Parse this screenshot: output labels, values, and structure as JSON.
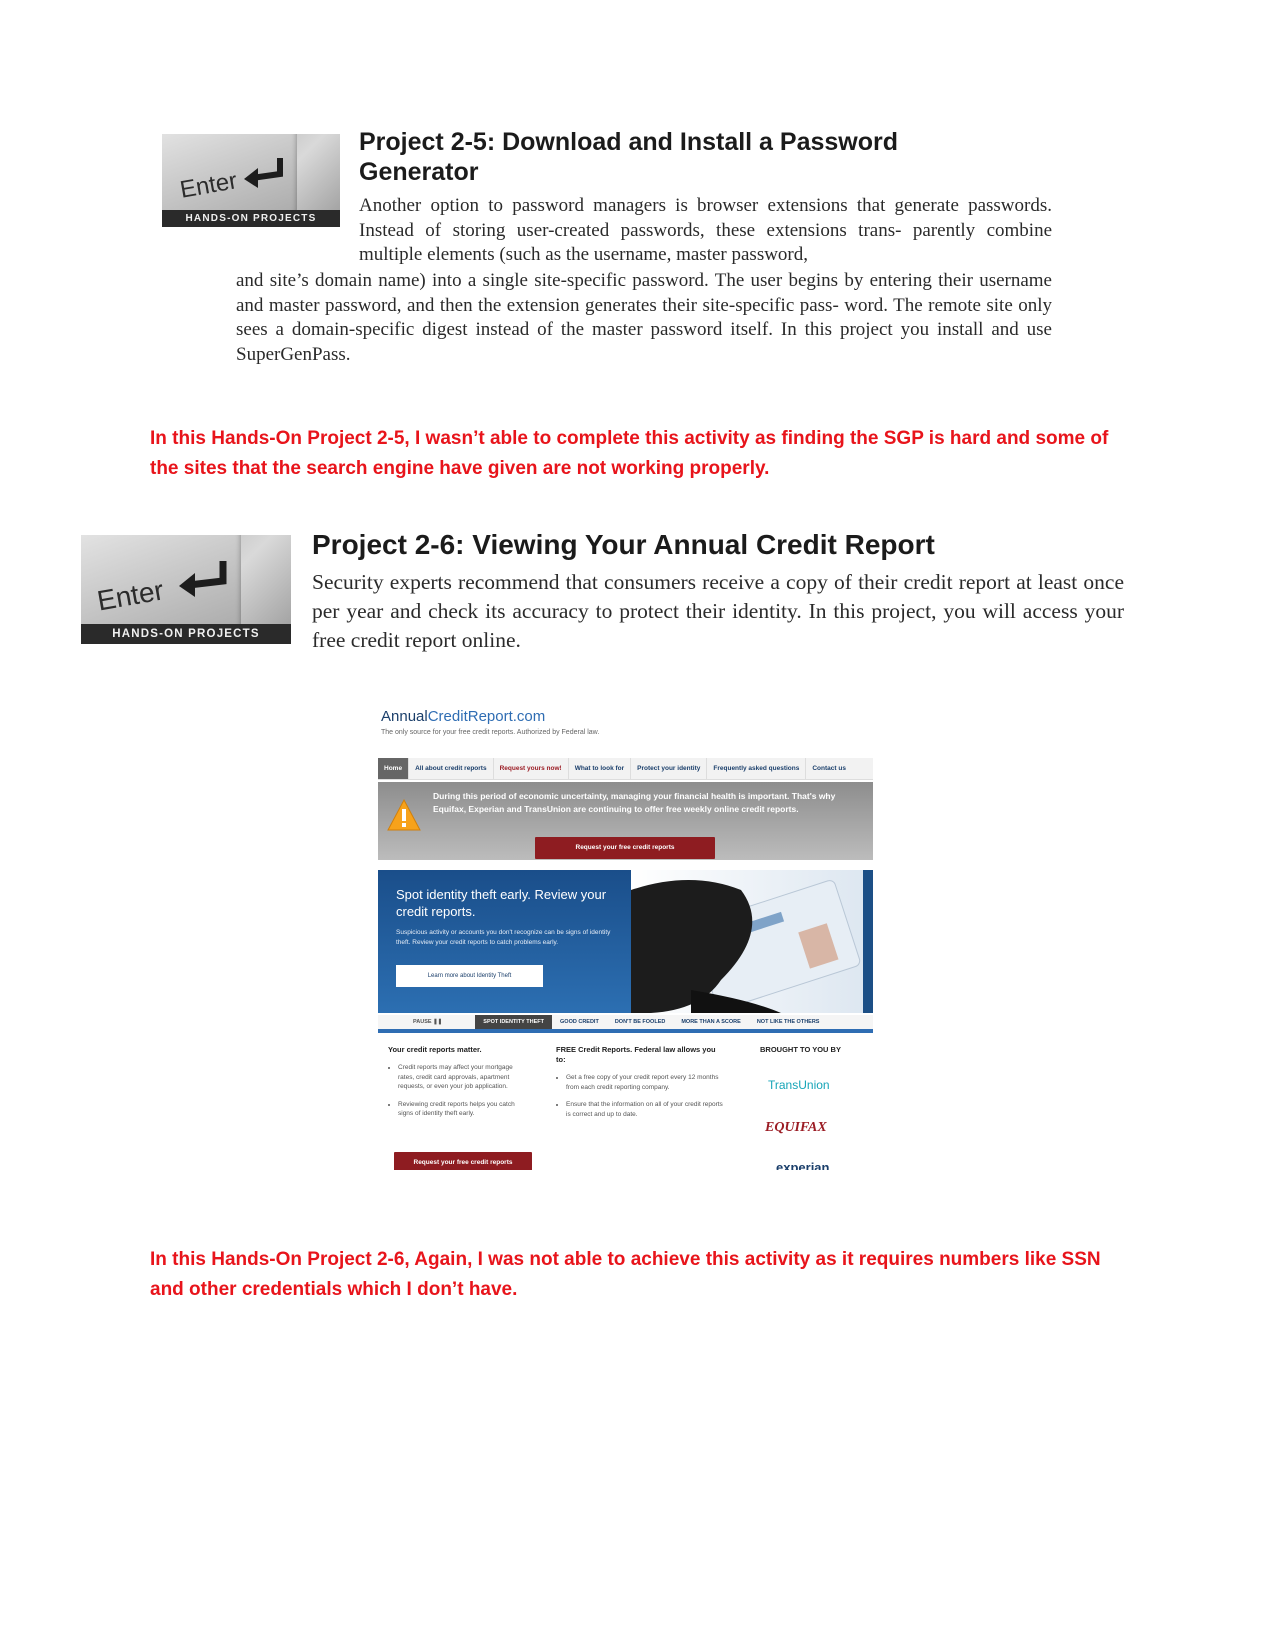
{
  "badge": {
    "enter_label": "Enter",
    "caption": "HANDS-ON PROJECTS"
  },
  "project_2_5": {
    "title_line1": "Project 2-5: Download and Install a Password",
    "title_line2": "Generator",
    "body_indented": "Another option to password managers is browser extensions that generate passwords. Instead of storing user-created passwords, these extensions trans- parently combine multiple elements (such as the username, master password,",
    "body_full": "and site’s domain name) into a single site-specific password. The user begins by entering their username and master password, and then the extension generates their site-specific pass- word. The remote site only sees a domain-specific digest instead of the master password itself. In this project you install and use SuperGenPass."
  },
  "note_2_5": "In this Hands-On Project 2-5, I wasn’t able to complete this activity as finding the SGP is hard and some of the sites that the search engine have given are not working properly.",
  "project_2_6": {
    "title": "Project 2-6: Viewing Your Annual Credit Report",
    "body": "Security experts recommend that consumers receive a copy of their credit report at least once per year and check its accuracy to protect their identity. In this project, you will access your free credit report online."
  },
  "site": {
    "logo_part1": "Annual",
    "logo_part2": "CreditReport.com",
    "tagline": "The only source for your free credit reports. Authorized by Federal law.",
    "nav": [
      "Home",
      "All about credit reports",
      "Request yours now!",
      "What to look for",
      "Protect your identity",
      "Frequently asked questions",
      "Contact us"
    ],
    "alert_text": "During this period of economic uncertainty, managing your financial health is important. That's why Equifax, Experian and TransUnion are continuing to offer free weekly online credit reports.",
    "alert_button": "Request your free credit reports",
    "hero_heading": "Spot identity theft early. Review your credit reports.",
    "hero_text": "Suspicious activity or accounts you don't recognize can be signs of identity theft. Review your credit reports to catch problems early.",
    "hero_button": "Learn more about Identity Theft",
    "tabs": [
      "PAUSE ❚❚",
      "SPOT IDENTITY THEFT",
      "GOOD CREDIT",
      "DON'T BE FOOLED",
      "MORE THAN A SCORE",
      "NOT LIKE THE OTHERS"
    ],
    "col1_heading": "Your credit reports matter.",
    "col1_items": [
      "Credit reports may affect your mortgage rates, credit card approvals, apartment requests, or even your job application.",
      "Reviewing credit reports helps you catch signs of identity theft early."
    ],
    "col2_heading": "FREE Credit Reports. Federal law allows you to:",
    "col2_items": [
      "Get a free copy of your credit report every 12 months from each credit reporting company.",
      "Ensure that the information on all of your credit reports is correct and up to date."
    ],
    "col3_heading": "BROUGHT TO YOU BY",
    "brand_transunion": "TransUnion",
    "brand_equifax": "EQUIFAX",
    "brand_experian": "experian",
    "bottom_button": "Request your free credit reports"
  },
  "note_2_6": "In this Hands-On Project 2-6, Again, I was not able to achieve this activity as it requires numbers like SSN and other credentials which I don’t have."
}
